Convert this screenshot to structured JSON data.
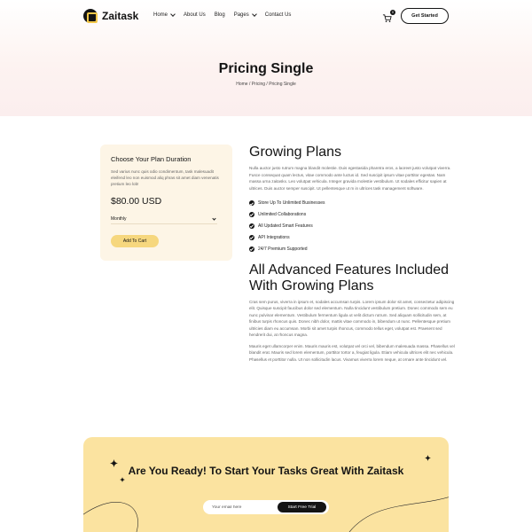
{
  "brand": {
    "name": "Zaitask"
  },
  "nav": {
    "items": [
      {
        "label": "Home",
        "has_dropdown": true
      },
      {
        "label": "About Us",
        "has_dropdown": false
      },
      {
        "label": "Blog",
        "has_dropdown": false
      },
      {
        "label": "Pages",
        "has_dropdown": true
      },
      {
        "label": "Contact Us",
        "has_dropdown": false
      }
    ],
    "cart_count": "0",
    "cta_label": "Get Started"
  },
  "hero": {
    "title": "Pricing Single",
    "breadcrumb": "Home / Pricing / Pricing Single"
  },
  "plan_card": {
    "title": "Choose Your Plan Duration",
    "description": "Sed varius nunc quis odio condimentum, task malesuadit eleifend leo non euismod aliq phras sit amet diam venenatis pretium leo lob!",
    "price": "$80.00 USD",
    "duration_selected": "Monthly",
    "add_to_cart_label": "Add To Cart"
  },
  "main": {
    "heading": "Growing Plans",
    "intro": "Nulla auctor justo rutrum magna blandit molestie. Duis egestasida pharetra eros, a laoreet justo volutpat viverra. Fusce consequat quam lectus, vitae commodo ante luctus id. Sed suscipit ipsum vitae porttitor egestas. Nam massa urna zaitaskx. Leo volutpat vehicula. Integer gravida molestie vestibulum. Ut sodales efficitur sapien at ultrices. Duis auctor semper suscipit. Ut pellentesque ut m in ultrices task management software.",
    "features": [
      "Store Up To Unlimited Businesses",
      "Unlimited Collaborations",
      "All Updated Smart Features",
      "API Integrations",
      "24/7 Premium Supported"
    ],
    "advanced_heading": "All Advanced Features Included With Growing Plans",
    "advanced_para_1": "Cras sem purus, viverra in ipsum et, sodales accumsan turpis. Lorem ipsum dolor sit amet, consectetur adipiscing elit. Quisque suscipit faucibus dolor sed elementum. Nulla tincidunt vestibulum pretium. Donec commodo sem eu nunc pulvinar elementum. Vestibulum fermentum ligula ut velit dictum rutrum. Sed aliquam sollicitudin sem, at finibus turpis rhoncus quis. Donec nibh dolor, mattis vitae commodo in, bibendum ut nunc. Pellentesque pretium ultricies diam eu accumsan. Morbi sit amet turpis rhoncus, commodo tellus eget, volutpat est. Praesent sed hendrerit dui, at rhoncus magna.",
    "advanced_para_2": "Mauris eget ullamcorper enim. Mauris mauris est, volutpat vel orci vel, bibendum malesuada massa. Phasellus vel blandit erat. Mauris sed lorem elementum, porttitor tortor a, feugiat ligula. Etiam vehicula ultrices elit nec vehicula. Phasellus et porttitor nulla. Ut non sollicitudin lacus. Vivamus viverra lorem neque, at ornare ante tincidunt vel."
  },
  "cta": {
    "title": "Are You Ready! To Start Your Tasks Great With Zaitask",
    "email_placeholder": "Your email here",
    "button_label": "Start Free Trial"
  },
  "colors": {
    "accent_yellow": "#f6d77e",
    "cta_background": "#fbe3a0",
    "card_background": "#fdf5e6",
    "dark": "#141414"
  }
}
